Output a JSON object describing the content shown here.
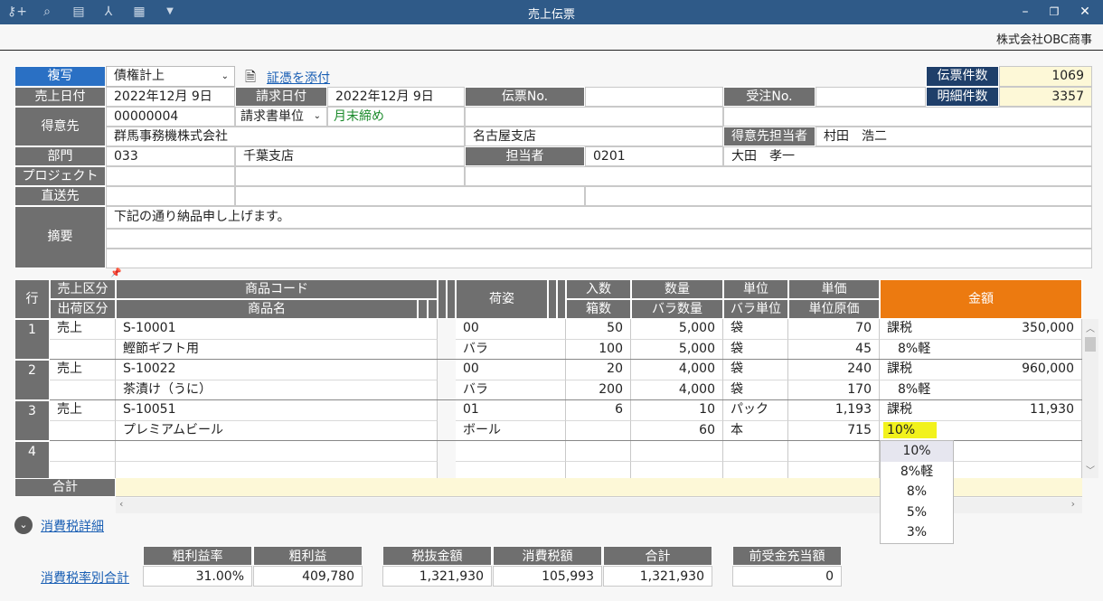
{
  "window": {
    "title": "売上伝票",
    "company": "株式会社OBC商事"
  },
  "toolbar": {
    "icons": [
      "key-add-icon",
      "search-icon",
      "print-icon",
      "pdf-icon",
      "excel-icon",
      "dropdown-icon"
    ]
  },
  "header": {
    "copy_label": "複写",
    "debt_type": "債権計上",
    "attach_label": "証憑を添付",
    "voucher_count_label": "伝票件数",
    "voucher_count": "1069",
    "detail_count_label": "明細件数",
    "detail_count": "3357",
    "sales_date_label": "売上日付",
    "sales_date": "2022年12月  9日",
    "billing_date_label": "請求日付",
    "billing_date": "2022年12月  9日",
    "voucher_no_label": "伝票No.",
    "voucher_no": "",
    "order_no_label": "受注No.",
    "order_no": "",
    "customer_label": "得意先",
    "customer_code": "00000004",
    "billing_unit": "請求書単位",
    "closing": "月末締め",
    "customer_name": "群馬事務機株式会社",
    "customer_branch": "名古屋支店",
    "customer_staff_label": "得意先担当者",
    "customer_staff": "村田　浩二",
    "dept_label": "部門",
    "dept_code": "033",
    "dept_name": "千葉支店",
    "staff_label": "担当者",
    "staff_code": "0201",
    "staff_name": "大田　孝一",
    "project_label": "プロジェクト",
    "direct_label": "直送先",
    "memo_label": "摘要",
    "memo": "下記の通り納品申し上げます。"
  },
  "table": {
    "col": {
      "row": "行",
      "sales_type": "売上区分",
      "ship_type": "出荷区分",
      "product_code": "商品コード",
      "product_name": "商品名",
      "packing": "荷姿",
      "qty_in": "入数",
      "boxes": "箱数",
      "qty": "数量",
      "loose_qty": "バラ数量",
      "unit": "単位",
      "loose_unit": "バラ単位",
      "price": "単価",
      "unit_cost": "単位原価",
      "amount": "金額"
    },
    "rows": [
      {
        "no": "1",
        "sales_type": "売上",
        "code": "S-10001",
        "name": "鰹節ギフト用",
        "pack1": "00",
        "pack2": "バラ",
        "qty_in": "50",
        "boxes": "100",
        "qty": "5,000",
        "loose_qty": "5,000",
        "unit": "袋",
        "loose_unit": "袋",
        "price": "70",
        "unit_cost": "45",
        "tax": "課税",
        "tax_rate": "8%軽",
        "amount": "350,000"
      },
      {
        "no": "2",
        "sales_type": "売上",
        "code": "S-10022",
        "name": "茶漬け（うに）",
        "pack1": "00",
        "pack2": "バラ",
        "qty_in": "20",
        "boxes": "200",
        "qty": "4,000",
        "loose_qty": "4,000",
        "unit": "袋",
        "loose_unit": "袋",
        "price": "240",
        "unit_cost": "170",
        "tax": "課税",
        "tax_rate": "8%軽",
        "amount": "960,000"
      },
      {
        "no": "3",
        "sales_type": "売上",
        "code": "S-10051",
        "name": "プレミアムビール",
        "pack1": "01",
        "pack2": "ボール",
        "qty_in": "6",
        "boxes": "",
        "qty": "10",
        "loose_qty": "60",
        "unit": "パック",
        "loose_unit": "本",
        "price": "1,193",
        "unit_cost": "715",
        "tax": "課税",
        "tax_rate": "10%",
        "amount": "11,930"
      },
      {
        "no": "4"
      }
    ],
    "total_label": "合計"
  },
  "tax_dropdown": {
    "options": [
      "10%",
      "8%軽",
      "8%",
      "5%",
      "3%"
    ],
    "selected": "10%"
  },
  "tax_detail_label": "消費税詳細",
  "tax_rate_total_label": "消費税率別合計",
  "summary": {
    "gross_margin_rate_label": "粗利益率",
    "gross_margin_rate": "31.00%",
    "gross_profit_label": "粗利益",
    "gross_profit": "409,780",
    "pre_tax_label": "税抜金額",
    "pre_tax": "1,321,930",
    "tax_label": "消費税額",
    "tax": "105,993",
    "total_label": "合計",
    "total": "1,321,930",
    "advance_label": "前受金充当額",
    "advance": "0"
  },
  "colors": {
    "titlebar": "#2f5a88",
    "label_gray": "#6f6f6f",
    "accent_orange": "#ec7a10",
    "highlight_yellow": "#f2f21c"
  }
}
